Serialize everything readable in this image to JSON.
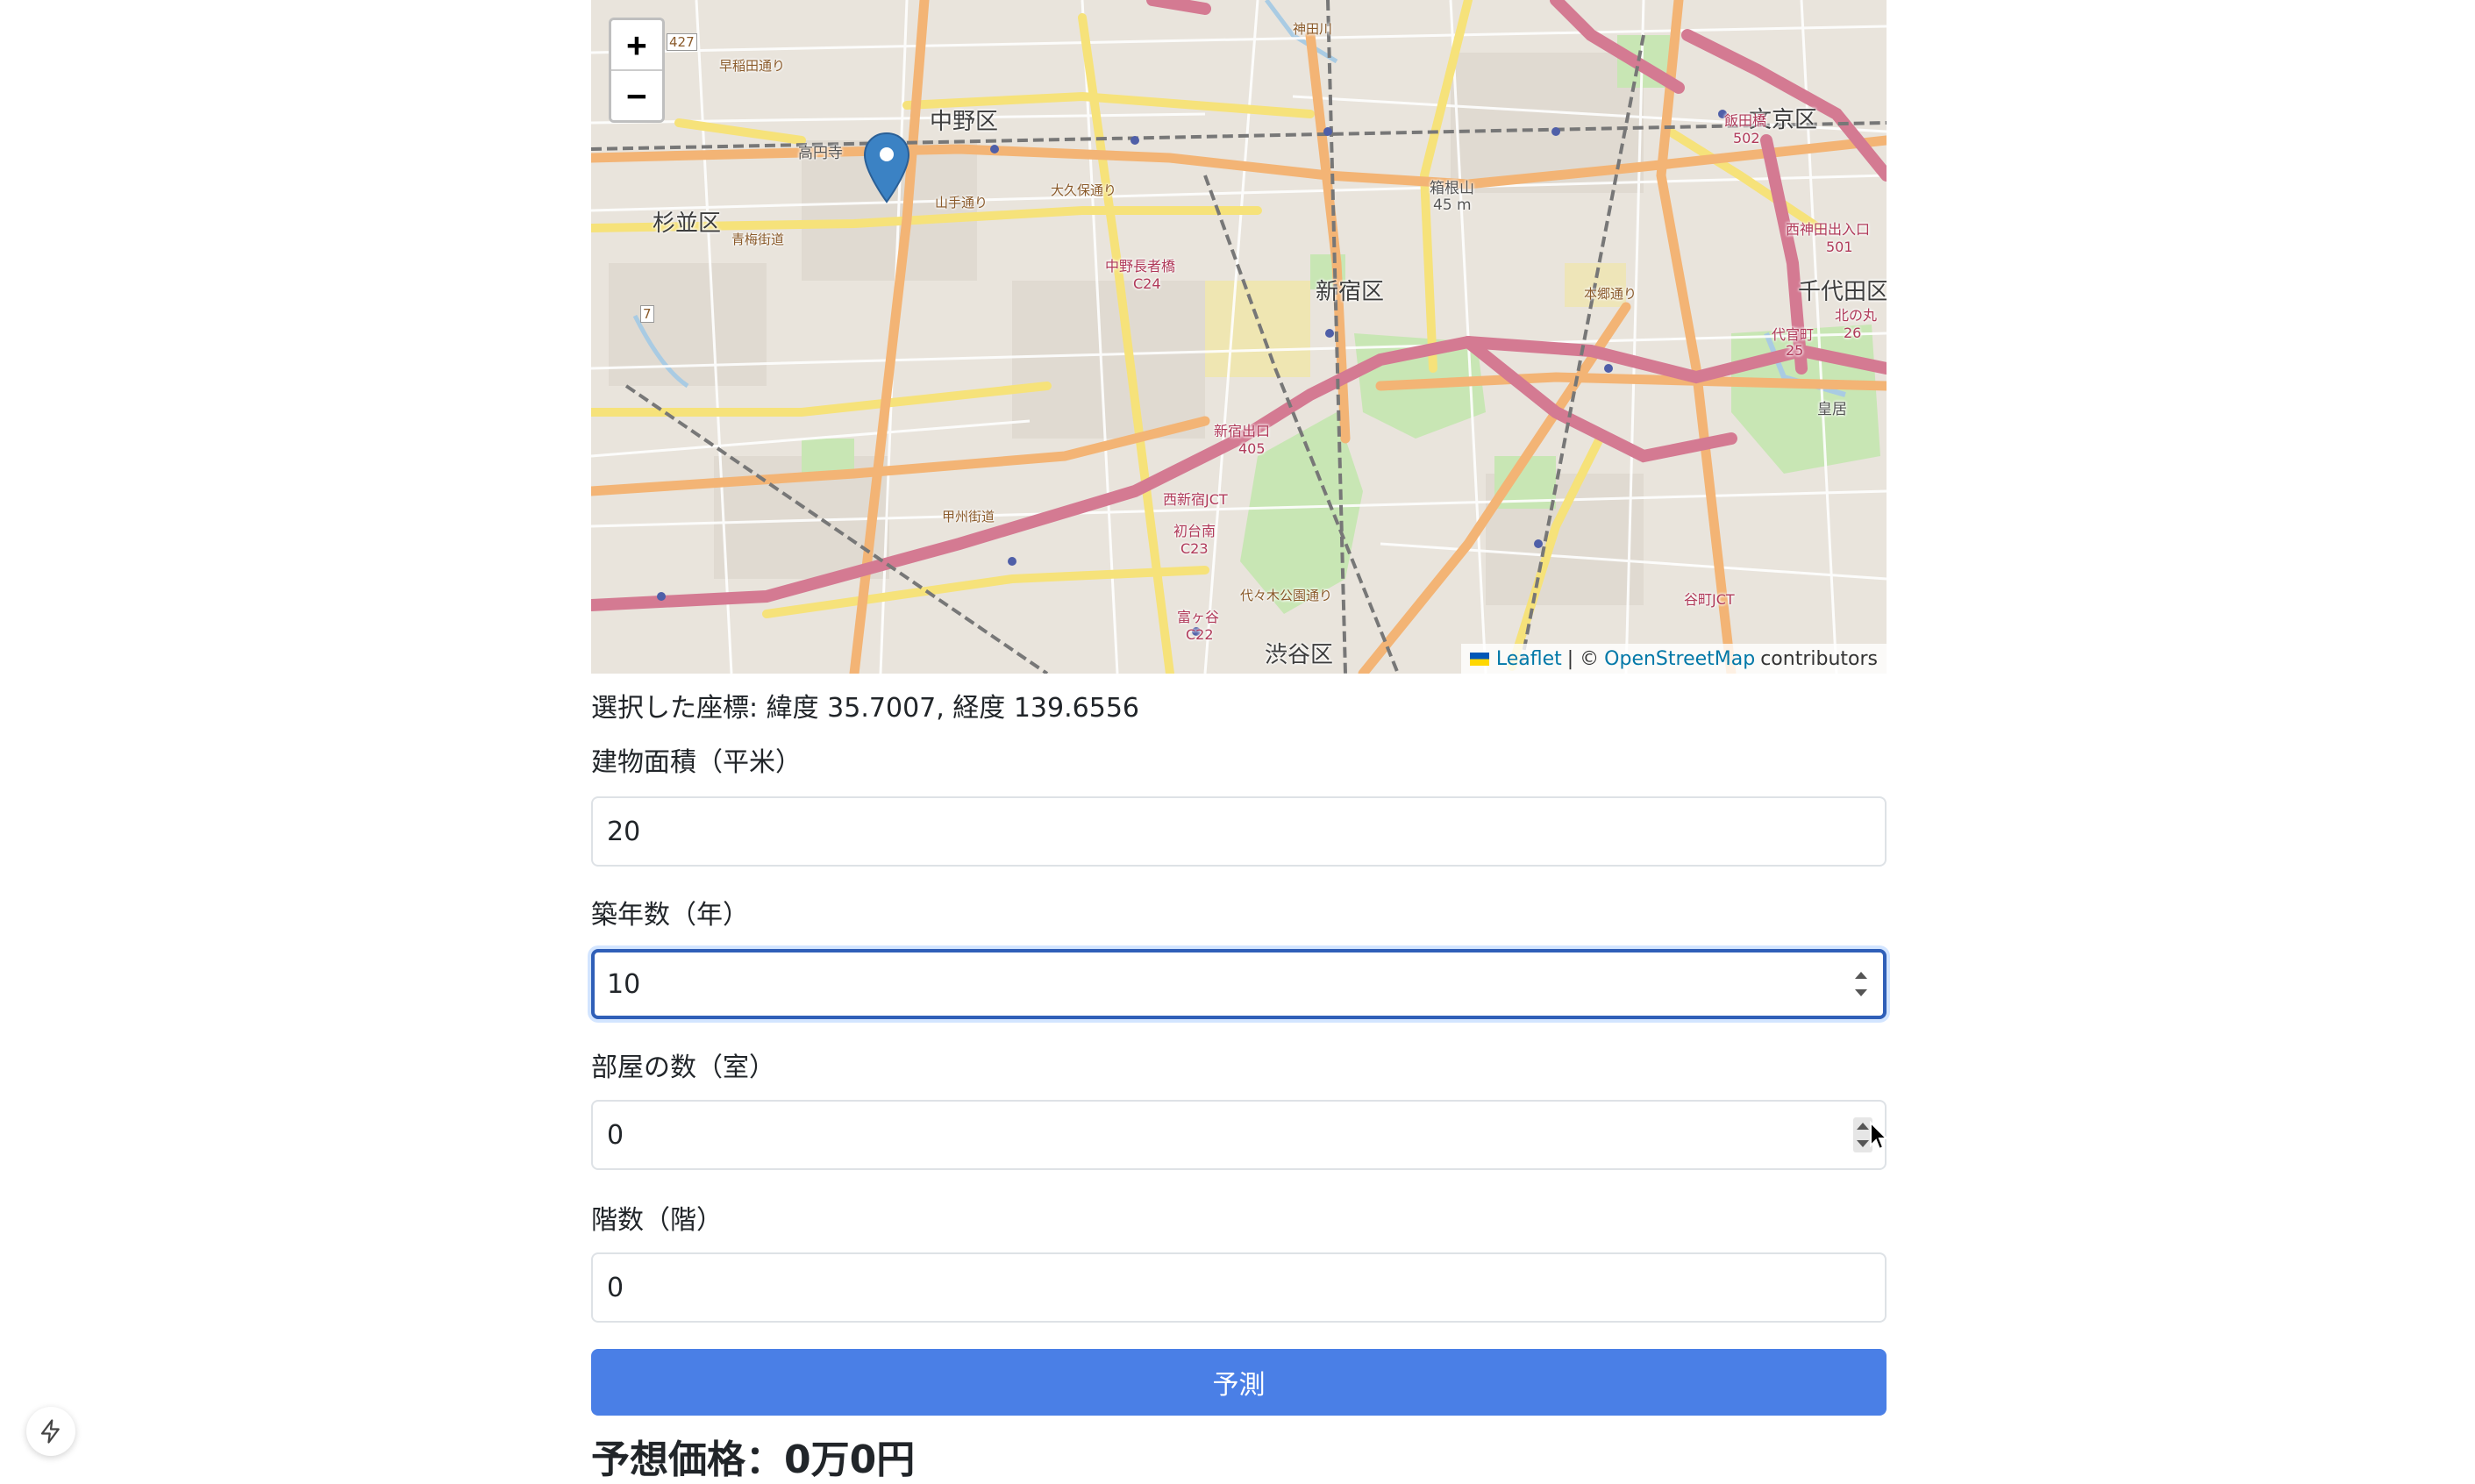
{
  "map": {
    "zoom_in": "+",
    "zoom_out": "−",
    "labels": {
      "nakano_ku": "中野区",
      "suginami_ku": "杉並区",
      "shinjuku_ku": "新宿区",
      "bunkyo_ku": "文京区",
      "chiyoda_ku": "千代田区",
      "shibuya_ku": "渋谷区",
      "koenji": "高円寺",
      "hakoneyama": "箱根山",
      "hakoneyama_height": "45 m",
      "nakano_chojabashi": "中野長者橋",
      "c24": "C24",
      "shinjuku_exit": "新宿出口",
      "r405": "405",
      "nishi_shinjuku_jct": "西新宿JCT",
      "hatsudai_minami": "初台南",
      "c23": "C23",
      "tomigaya": "富ヶ谷",
      "c22": "C22",
      "iidabashi": "飯田橋",
      "r502": "502",
      "nishikanda_exit": "西神田出入口",
      "r501": "501",
      "daikancho": "代官町",
      "r25": "25",
      "kitanomaru": "北の丸",
      "r26": "26",
      "kokyo": "皇居",
      "yoyogi_park": "代々木公園通り",
      "tanimachi_jct": "谷町JCT",
      "kanda_river": "神田川",
      "r427": "427",
      "r7": "7",
      "ome_kaido": "青梅街道",
      "waseda_dori": "早稲田通り",
      "okubo_dori": "大久保通り",
      "yamate_dori": "山手通り",
      "koshu_kaido": "甲州街道",
      "hongo_dori": "本郷通り"
    },
    "attribution": {
      "leaflet": "Leaflet",
      "sep": "| ©",
      "osm": "OpenStreetMap",
      "contributors": "contributors"
    }
  },
  "selected_coords": "選択した座標: 緯度 35.7007, 経度 139.6556",
  "form": {
    "area_label": "建物面積（平米）",
    "area_value": "20",
    "age_label": "築年数（年）",
    "age_value": "10",
    "rooms_label": "部屋の数（室）",
    "rooms_value": "0",
    "floors_label": "階数（階）",
    "floors_value": "0",
    "predict_label": "予測"
  },
  "result_text": "予想価格：0万0円",
  "colors": {
    "accent": "#4a7fe6",
    "focus_border": "#2f5fb8",
    "marker": "#3b82c4"
  },
  "icons": {
    "marker": "map-pin-icon",
    "bolt": "lightning-bolt-icon",
    "cursor": "mouse-pointer-icon"
  }
}
